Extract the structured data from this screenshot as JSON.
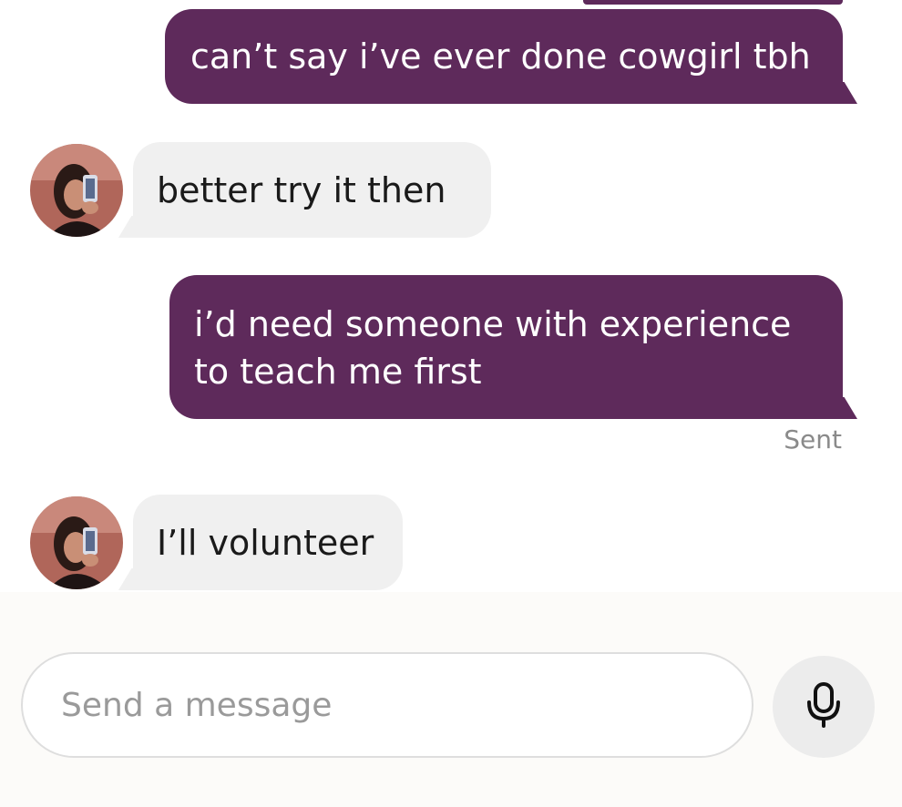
{
  "conversation": {
    "messages": [
      {
        "direction": "outgoing",
        "text": "can’t say i’ve ever done cowgirl tbh"
      },
      {
        "direction": "incoming",
        "text": "better try it then"
      },
      {
        "direction": "outgoing",
        "text": "i’d need someone with experience to teach me first",
        "status": "Sent"
      },
      {
        "direction": "incoming",
        "text": "I’ll volunteer"
      }
    ]
  },
  "composer": {
    "placeholder": "Send a message",
    "mic_icon": "microphone-icon"
  },
  "colors": {
    "outgoing_bubble": "#5e2a5b",
    "incoming_bubble": "#f0f0f0",
    "status_text": "#8a8a8a",
    "mic_button_bg": "#ececec"
  }
}
